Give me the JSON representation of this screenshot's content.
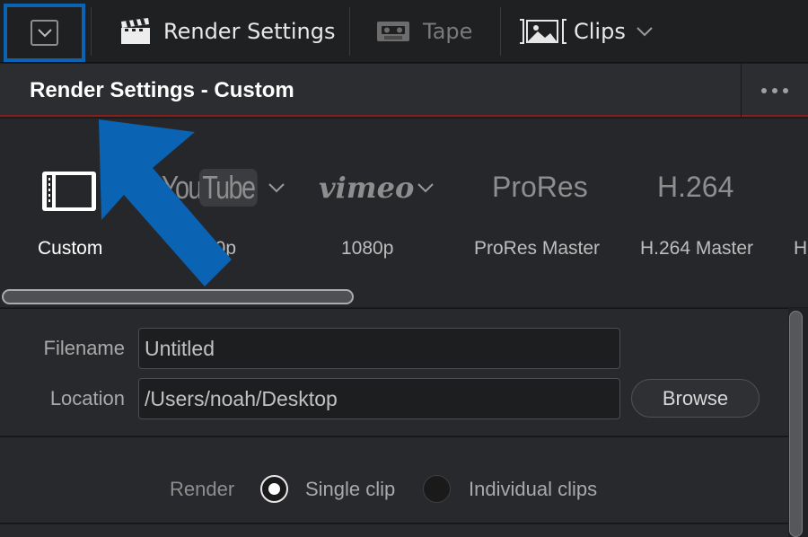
{
  "toolbar": {
    "collapse_icon": "chevron-down-icon",
    "render_settings": {
      "icon": "clapperboard-icon",
      "label": "Render Settings"
    },
    "tape": {
      "icon": "cassette-icon",
      "label": "Tape"
    },
    "clips": {
      "icon": "clips-icon",
      "label": "Clips",
      "dropdown_icon": "chevron-down-icon"
    }
  },
  "panel": {
    "title": "Render Settings - Custom",
    "more_icon": "more-icon"
  },
  "presets": [
    {
      "logo": "film-icon",
      "label": "Custom",
      "selected": true
    },
    {
      "logo_text_1": "You",
      "logo_text_2": "Tube",
      "label": "1080p",
      "label_visible": "80p"
    },
    {
      "logo_text": "vimeo",
      "label": "1080p"
    },
    {
      "logo_text": "ProRes",
      "label": "ProRes Master"
    },
    {
      "logo_text": "H.264",
      "label": "H.264 Master"
    },
    {
      "label": "H"
    }
  ],
  "form": {
    "filename_label": "Filename",
    "filename_value": "Untitled",
    "location_label": "Location",
    "location_value": "/Users/noah/Desktop",
    "browse_label": "Browse"
  },
  "render": {
    "label": "Render",
    "single_clip": "Single clip",
    "individual_clips": "Individual clips",
    "selected": "single_clip"
  },
  "colors": {
    "annotation": "#0a63b3",
    "header_accent": "#8b1d1d"
  }
}
